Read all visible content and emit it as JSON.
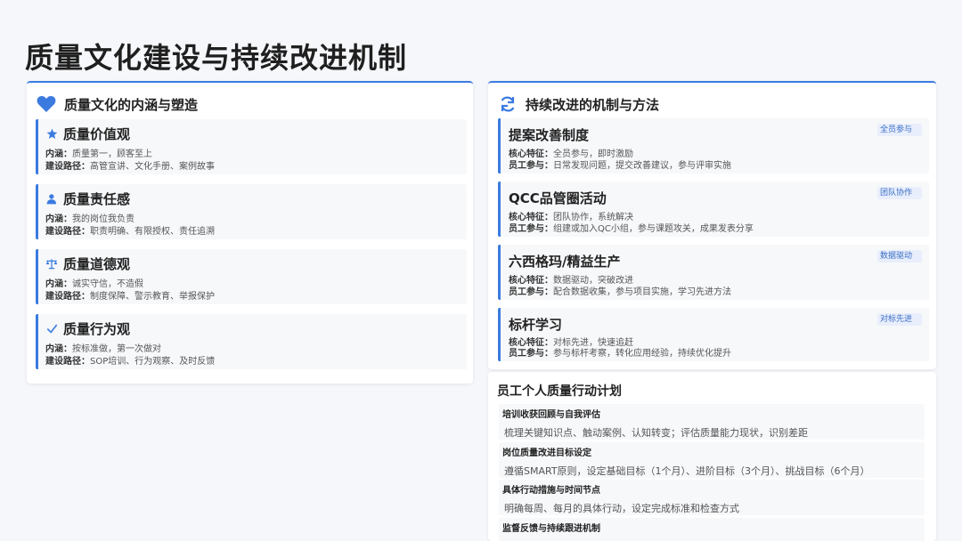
{
  "page_title": "质量文化建设与持续改进机制",
  "left_panel": {
    "title": "质量文化的内涵与塑造",
    "icon": "heart-icon",
    "cards": [
      {
        "icon": "star-icon",
        "name": "质量价值观",
        "connotation_label": "内涵：",
        "connotation": "质量第一，顾客至上",
        "path_label": "建设路径：",
        "path": "高管宣讲、文化手册、案例故事"
      },
      {
        "icon": "user-icon",
        "name": "质量责任感",
        "connotation_label": "内涵：",
        "connotation": "我的岗位我负责",
        "path_label": "建设路径：",
        "path": "职责明确、有限授权、责任追溯"
      },
      {
        "icon": "scale-icon",
        "name": "质量道德观",
        "connotation_label": "内涵：",
        "connotation": "诚实守信，不造假",
        "path_label": "建设路径：",
        "path": "制度保障、警示教育、举报保护"
      },
      {
        "icon": "check-icon",
        "name": "质量行为观",
        "connotation_label": "内涵：",
        "connotation": "按标准做，第一次做对",
        "path_label": "建设路径：",
        "path": "SOP培训、行为观察、及时反馈"
      }
    ]
  },
  "right_panel": {
    "title": "持续改进的机制与方法",
    "icon": "refresh-icon",
    "cards": [
      {
        "name": "提案改善制度",
        "feature_label": "核心特征：",
        "feature": "全员参与，即时激励",
        "participation_label": "员工参与：",
        "participation": "日常发现问题，提交改善建议，参与评审实施",
        "tag": "全员参与"
      },
      {
        "name": "QCC品管圈活动",
        "feature_label": "核心特征：",
        "feature": "团队协作，系统解决",
        "participation_label": "员工参与：",
        "participation": "组建或加入QC小组，参与课题攻关，成果发表分享",
        "tag": "团队协作"
      },
      {
        "name": "六西格玛/精益生产",
        "feature_label": "核心特征：",
        "feature": "数据驱动，突破改进",
        "participation_label": "员工参与：",
        "participation": "配合数据收集，参与项目实施，学习先进方法",
        "tag": "数据驱动"
      },
      {
        "name": "标杆学习",
        "feature_label": "核心特征：",
        "feature": "对标先进，快速追赶",
        "participation_label": "员工参与：",
        "participation": "参与标杆考察，转化应用经验，持续优化提升",
        "tag": "对标先进"
      }
    ]
  },
  "plan": {
    "title": "员工个人质量行动计划",
    "items": [
      {
        "head": "培训收获回顾与自我评估",
        "desc": "梳理关键知识点、触动案例、认知转变；评估质量能力现状，识别差距"
      },
      {
        "head": "岗位质量改进目标设定",
        "desc": "遵循SMART原则，设定基础目标（1个月）、进阶目标（3个月）、挑战目标（6个月）"
      },
      {
        "head": "具体行动措施与时间节点",
        "desc": "明确每周、每月的具体行动，设定完成标准和检查方式"
      },
      {
        "head": "监督反馈与持续跟进机制",
        "desc": ""
      }
    ]
  },
  "colors": {
    "accent": "#3b7be0",
    "tag_bg": "#e8eefb",
    "card_bg": "#f7f8fa"
  }
}
